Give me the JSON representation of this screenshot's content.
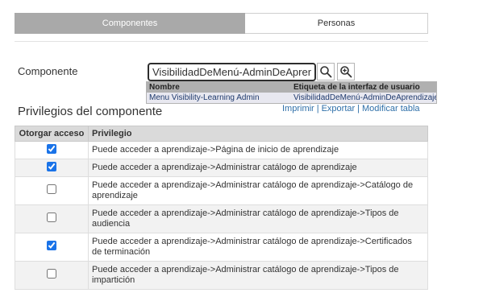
{
  "tabs": {
    "active": "Componentes",
    "inactive": "Personas"
  },
  "component": {
    "label": "Componente",
    "value": "VisibilidadDeMenú-AdminDeAprendizaje"
  },
  "suggestions": {
    "header_name": "Nombre",
    "header_label": "Etiqueta de la interfaz de usuario",
    "row_name": "Menu Visibility-Learning Admin",
    "row_label": "VisibilidadDeMenú-AdminDeAprendizaje"
  },
  "privileges": {
    "title": "Privilegios del componente",
    "actions": {
      "print": "Imprimir",
      "export": "Exportar",
      "modify": "Modificar tabla",
      "separator": "|"
    },
    "columns": {
      "grant": "Otorgar acceso",
      "privilege": "Privilegio"
    },
    "rows": [
      {
        "checked": true,
        "text": "Puede acceder a aprendizaje->Página de inicio de aprendizaje"
      },
      {
        "checked": true,
        "text": "Puede acceder a aprendizaje->Administrar catálogo de aprendizaje"
      },
      {
        "checked": false,
        "text": "Puede acceder a aprendizaje->Administrar catálogo de aprendizaje->Catálogo de aprendizaje"
      },
      {
        "checked": false,
        "text": "Puede acceder a aprendizaje->Administrar catálogo de aprendizaje->Tipos de audiencia"
      },
      {
        "checked": true,
        "text": "Puede acceder a aprendizaje->Administrar catálogo de aprendizaje->Certificados de terminación"
      },
      {
        "checked": false,
        "text": "Puede acceder a aprendizaje->Administrar catálogo de aprendizaje->Tipos de impartición"
      }
    ]
  },
  "icons": {
    "search": "search-icon",
    "lookup": "zoom-search-icon"
  }
}
